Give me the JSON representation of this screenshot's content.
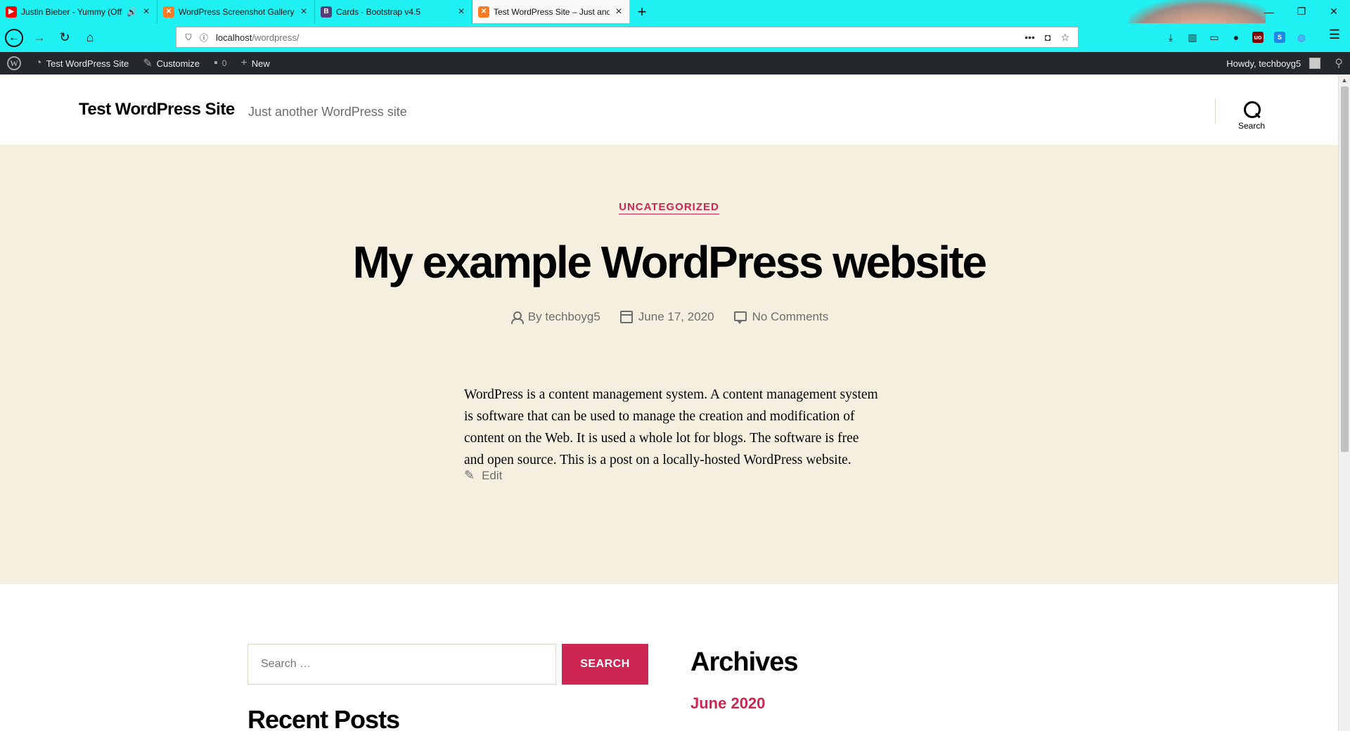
{
  "browser": {
    "tabs": [
      {
        "title": "Justin Bieber - Yummy (Offi",
        "favicon": "youtube-icon",
        "favicon_color": "#ff0000",
        "audio": true,
        "active": false
      },
      {
        "title": "WordPress Screenshot Gallery",
        "favicon": "xampp-icon",
        "favicon_color": "#fb7a24",
        "audio": false,
        "active": false
      },
      {
        "title": "Cards · Bootstrap v4.5",
        "favicon": "bootstrap-icon",
        "favicon_color": "#563d7c",
        "audio": false,
        "active": false
      },
      {
        "title": "Test WordPress Site – Just anot",
        "favicon": "xampp-icon",
        "favicon_color": "#fb7a24",
        "audio": false,
        "active": true
      }
    ],
    "url_host": "localhost",
    "url_path": "/wordpress/",
    "accent_color": "#1ff1f3"
  },
  "adminbar": {
    "site_name": "Test WordPress Site",
    "customize": "Customize",
    "comments_count": "0",
    "new_label": "New",
    "howdy": "Howdy, techboyg5"
  },
  "header": {
    "site_title": "Test WordPress Site",
    "site_description": "Just another WordPress site",
    "search_label": "Search"
  },
  "post": {
    "category": "UNCATEGORIZED",
    "title": "My example WordPress website",
    "author": "By techboyg5",
    "date": "June 17, 2020",
    "comments": "No Comments",
    "content": "WordPress is a content management system. A content management system is software that can be used to manage the creation and modification of content on the Web. It is used a whole lot for blogs. The software is free and open source. This is a post on a locally-hosted WordPress website.",
    "edit_label": "Edit",
    "accent_color": "#cd2653",
    "hero_bg": "#f5efe0"
  },
  "widgets": {
    "search_placeholder": "Search …",
    "search_button": "SEARCH",
    "recent_posts_title": "Recent Posts",
    "archives_title": "Archives",
    "archive_link": "June 2020"
  }
}
